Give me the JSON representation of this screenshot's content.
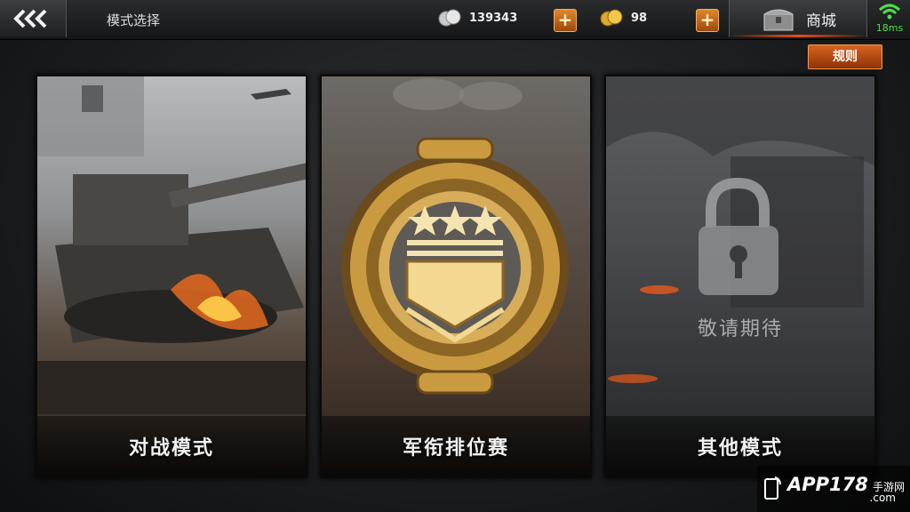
{
  "header": {
    "title": "模式选择",
    "silver_amount": "139343",
    "gold_amount": "98",
    "plus_label": "+",
    "shop_label": "商城",
    "ping": "18ms"
  },
  "rules_label": "规则",
  "cards": [
    {
      "label": "对战模式"
    },
    {
      "label": "军衔排位赛"
    },
    {
      "label": "其他模式",
      "locked_text": "敬请期待"
    }
  ],
  "watermark": {
    "brand": "APP178",
    "site": "手游网",
    "domain": ".com"
  },
  "colors": {
    "accent": "#d7641f",
    "ping_green": "#4be04b",
    "gold": "#e3b04a"
  }
}
